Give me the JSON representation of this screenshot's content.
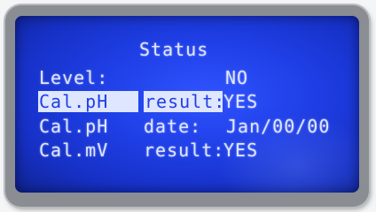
{
  "screen": {
    "title": "Status",
    "rows": [
      {
        "label": "Level:",
        "value": "NO"
      },
      {
        "label_a": "Cal.pH",
        "label_b": "result:",
        "value": "YES"
      },
      {
        "label_a": "Cal.pH",
        "label_b": "date:",
        "value": "Jan/00/00"
      },
      {
        "label_a": "Cal.mV",
        "label_b": "result:",
        "value": "YES"
      }
    ]
  },
  "colors": {
    "lcd_background": "#1f3fe6",
    "lcd_text": "#dfe6ff",
    "bezel": "#8a8d92"
  }
}
